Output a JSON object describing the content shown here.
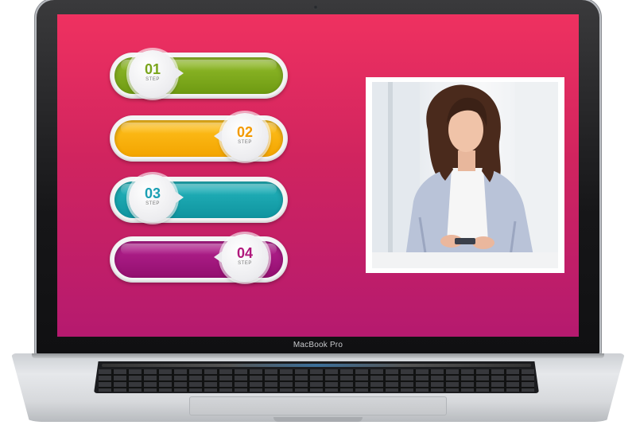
{
  "device": {
    "brand_label": "MacBook Pro"
  },
  "colors": {
    "screen_top": "#ef3160",
    "screen_bottom": "#b51a6f",
    "step1": "#7aa51c",
    "step2": "#ffb000",
    "step3": "#1aa7b0",
    "step4": "#a5187f"
  },
  "steps": [
    {
      "number": "01",
      "label": "STEP",
      "color": "#86b022",
      "badge_side": "left"
    },
    {
      "number": "02",
      "label": "STEP",
      "color": "#fbb402",
      "badge_side": "right"
    },
    {
      "number": "03",
      "label": "STEP",
      "color": "#15a2b2",
      "badge_side": "left"
    },
    {
      "number": "04",
      "label": "STEP",
      "color": "#a6187f",
      "badge_side": "right"
    }
  ],
  "photo": {
    "subject_icon": "woman-with-phone-icon"
  }
}
